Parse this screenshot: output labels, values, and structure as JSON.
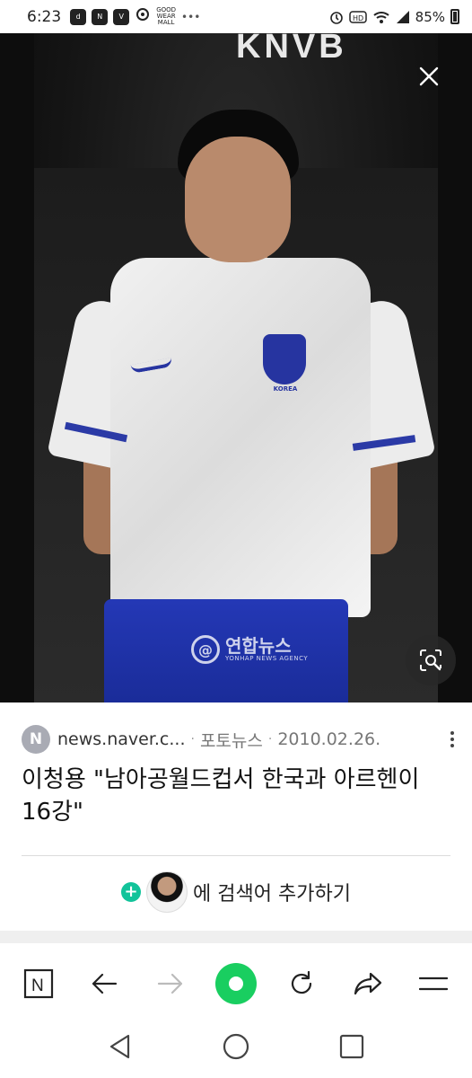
{
  "status_bar": {
    "time": "6:23",
    "notif_icons": [
      "dsmart",
      "netflix",
      "tving",
      "alarm"
    ],
    "notif_text": "GOOD\nWEAR\nMALL",
    "battery": "85%"
  },
  "viewer": {
    "photo_text": "KNVB",
    "watermark_kr": "연합뉴스",
    "watermark_en": "YONHAP NEWS AGENCY",
    "jersey_text": "KOREA",
    "close_icon": "close-icon",
    "lens_icon": "image-search-icon"
  },
  "source": {
    "logo": "N",
    "domain": "news.naver.c...",
    "category": "포토뉴스",
    "date": "2010.02.26."
  },
  "headline": "이청용 \"남아공월드컵서 한국과 아르헨이 16강\"",
  "add_search": {
    "plus": "+",
    "label": "에 검색어 추가하기"
  },
  "toolbar": {
    "home_label": "N"
  },
  "colors": {
    "accent_green": "#19ce60",
    "plus_teal": "#12c39a"
  }
}
